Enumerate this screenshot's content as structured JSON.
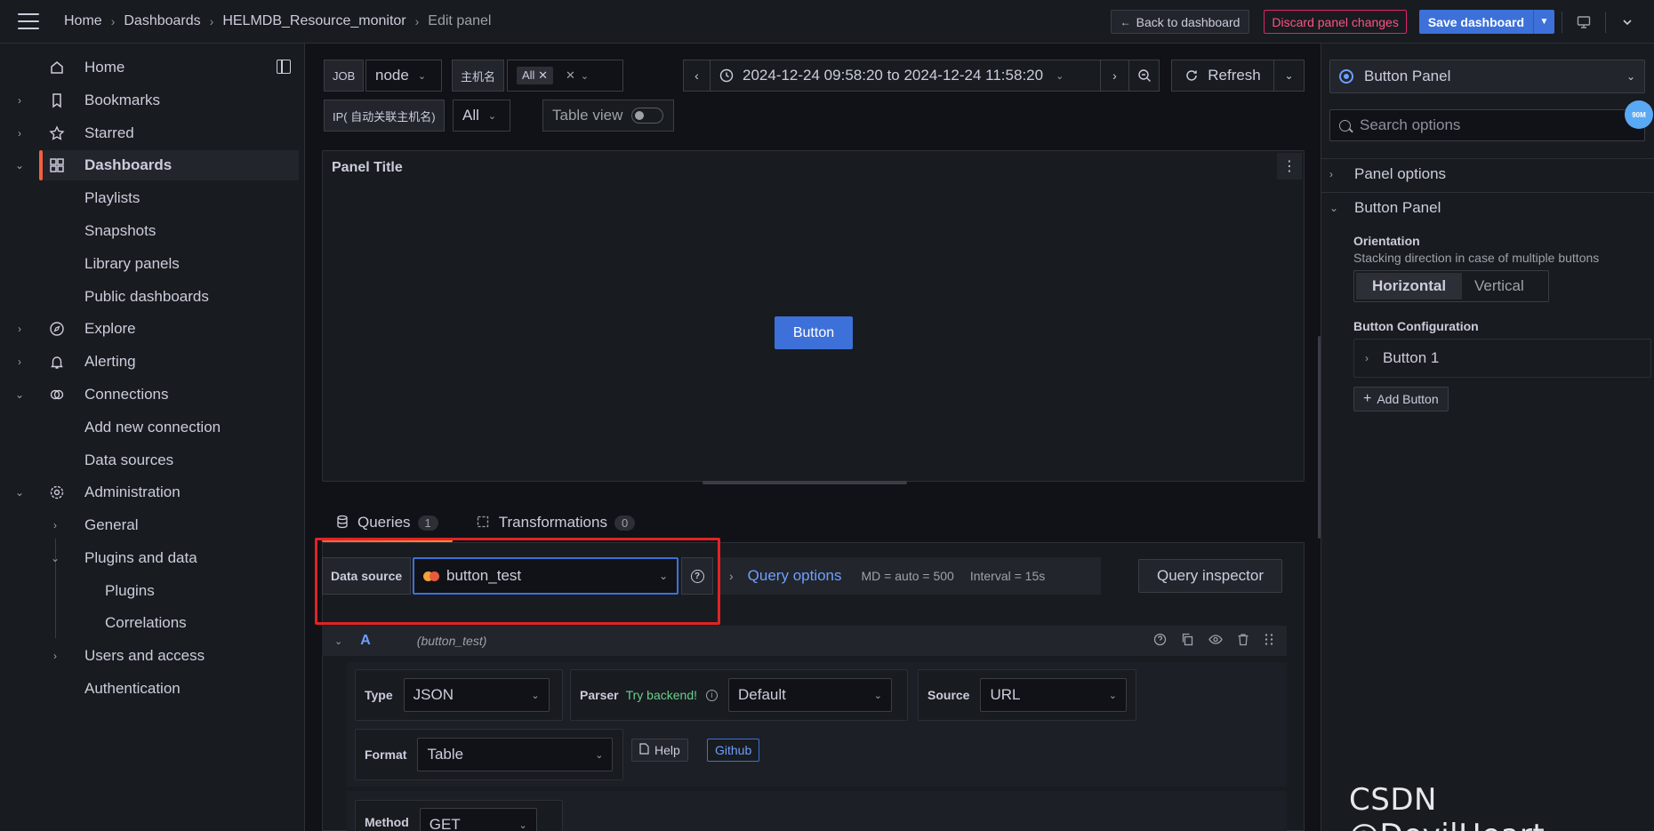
{
  "topbar": {
    "breadcrumbs": [
      "Home",
      "Dashboards",
      "HELMDB_Resource_monitor",
      "Edit panel"
    ],
    "back_label": "Back to dashboard",
    "discard_label": "Discard panel changes",
    "save_label": "Save dashboard"
  },
  "sidebar": {
    "items": [
      {
        "label": "Home",
        "icon": "home-icon"
      },
      {
        "label": "Bookmarks",
        "icon": "bookmark-icon"
      },
      {
        "label": "Starred",
        "icon": "star-icon"
      },
      {
        "label": "Dashboards",
        "icon": "apps-icon",
        "active": true
      },
      {
        "label": "Playlists"
      },
      {
        "label": "Snapshots"
      },
      {
        "label": "Library panels"
      },
      {
        "label": "Public dashboards"
      },
      {
        "label": "Explore",
        "icon": "compass-icon"
      },
      {
        "label": "Alerting",
        "icon": "bell-icon"
      },
      {
        "label": "Connections",
        "icon": "link-icon"
      },
      {
        "label": "Add new connection"
      },
      {
        "label": "Data sources"
      },
      {
        "label": "Administration",
        "icon": "cog-icon"
      },
      {
        "label": "General"
      },
      {
        "label": "Plugins and data"
      },
      {
        "label": "Plugins"
      },
      {
        "label": "Correlations"
      },
      {
        "label": "Users and access"
      },
      {
        "label": "Authentication"
      }
    ]
  },
  "variables": {
    "job_label": "JOB",
    "job_value": "node",
    "host_label": "主机名",
    "host_chip": "All",
    "ip_label": "IP( 自动关联主机名)",
    "ip_value": "All",
    "table_view_label": "Table view"
  },
  "time": {
    "range": "2024-12-24 09:58:20 to 2024-12-24 11:58:20",
    "refresh_label": "Refresh"
  },
  "panel": {
    "title": "Panel Title",
    "button_label": "Button"
  },
  "tabs": [
    {
      "label": "Queries",
      "count": "1"
    },
    {
      "label": "Transformations",
      "count": "0"
    }
  ],
  "query": {
    "ds_label": "Data source",
    "ds_value": "button_test",
    "options_title": "Query options",
    "options_md": "MD = auto = 500",
    "options_interval": "Interval = 15s",
    "inspector_label": "Query inspector",
    "ref_id": "A",
    "ref_ds": "(button_test)",
    "type_label": "Type",
    "type_value": "JSON",
    "parser_label": "Parser",
    "parser_hint": "Try backend!",
    "parser_value": "Default",
    "source_label": "Source",
    "source_value": "URL",
    "format_label": "Format",
    "format_value": "Table",
    "help_label": "Help",
    "github_label": "Github",
    "method_label": "Method",
    "method_value": "GET"
  },
  "options_pane": {
    "viz_name": "Button Panel",
    "search_placeholder": "Search options",
    "avatar_text": "90M",
    "section_panel_options": "Panel options",
    "section_button_panel": "Button Panel",
    "orientation_label": "Orientation",
    "orientation_desc": "Stacking direction in case of multiple buttons",
    "orientation_options": [
      "Horizontal",
      "Vertical"
    ],
    "orientation_selected": "Horizontal",
    "button_config_label": "Button Configuration",
    "button_item": "Button 1",
    "add_button_label": "Add Button"
  },
  "watermark": "CSDN @DevilHeart,,,,"
}
